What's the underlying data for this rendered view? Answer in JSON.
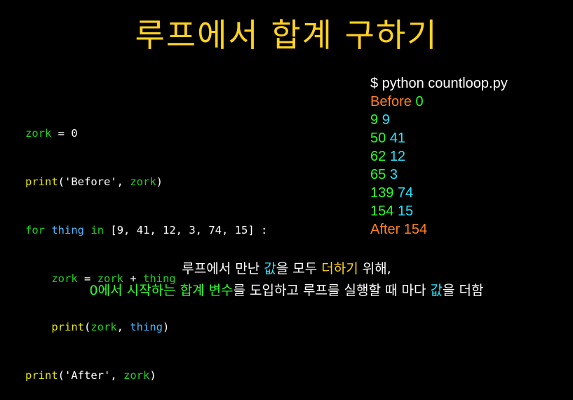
{
  "title": "루프에서 합계 구하기",
  "code": {
    "line1": {
      "var": "zork",
      "rest": " = 0"
    },
    "line2": {
      "fn": "print",
      "open": "(",
      "str": "'Before'",
      "comma": ", ",
      "arg": "zork",
      "close": ")"
    },
    "line3": {
      "for": "for",
      "sp1": " ",
      "thing": "thing",
      "sp2": " ",
      "in": "in",
      "rest": " [9, 41, 12, 3, 74, 15] :"
    },
    "line4": {
      "indent": "    ",
      "zork": "zork",
      "eq": " = ",
      "zork2": "zork",
      "plus": " + ",
      "thing": "thing"
    },
    "line5": {
      "indent": "    ",
      "fn": "print",
      "open": "(",
      "zork": "zork",
      "comma": ", ",
      "thing": "thing",
      "close": ")"
    },
    "line6": {
      "fn": "print",
      "open": "(",
      "str": "'After'",
      "comma": ", ",
      "arg": "zork",
      "close": ")"
    }
  },
  "output": {
    "command": "$ python countloop.py",
    "before_label": "Before",
    "before_value": "0",
    "rows": [
      {
        "zork": "9",
        "thing": "9"
      },
      {
        "zork": "50",
        "thing": "41"
      },
      {
        "zork": "62",
        "thing": "12"
      },
      {
        "zork": "65",
        "thing": "3"
      },
      {
        "zork": "139",
        "thing": "74"
      },
      {
        "zork": "154",
        "thing": "15"
      }
    ],
    "after": "After 154"
  },
  "caption": {
    "l1_a": "루프에서 만난 ",
    "l1_b": "값",
    "l1_c": "을 모두 ",
    "l1_d": "더하기",
    "l1_e": " 위해,",
    "l2_a": "0에서 시작하는 합계 변수",
    "l2_b": "를 도입하고 루프를 실행할 때 마다 ",
    "l2_c": "값",
    "l2_d": "을 더함"
  },
  "colors": {
    "background": "#000000",
    "title": "#ffd21f",
    "keyword": "#1fd21f",
    "function": "#e6e600",
    "thing": "#4ab8ff",
    "output_orange": "#ff8022",
    "output_green": "#2dff2d",
    "output_cyan": "#27e5ff"
  }
}
